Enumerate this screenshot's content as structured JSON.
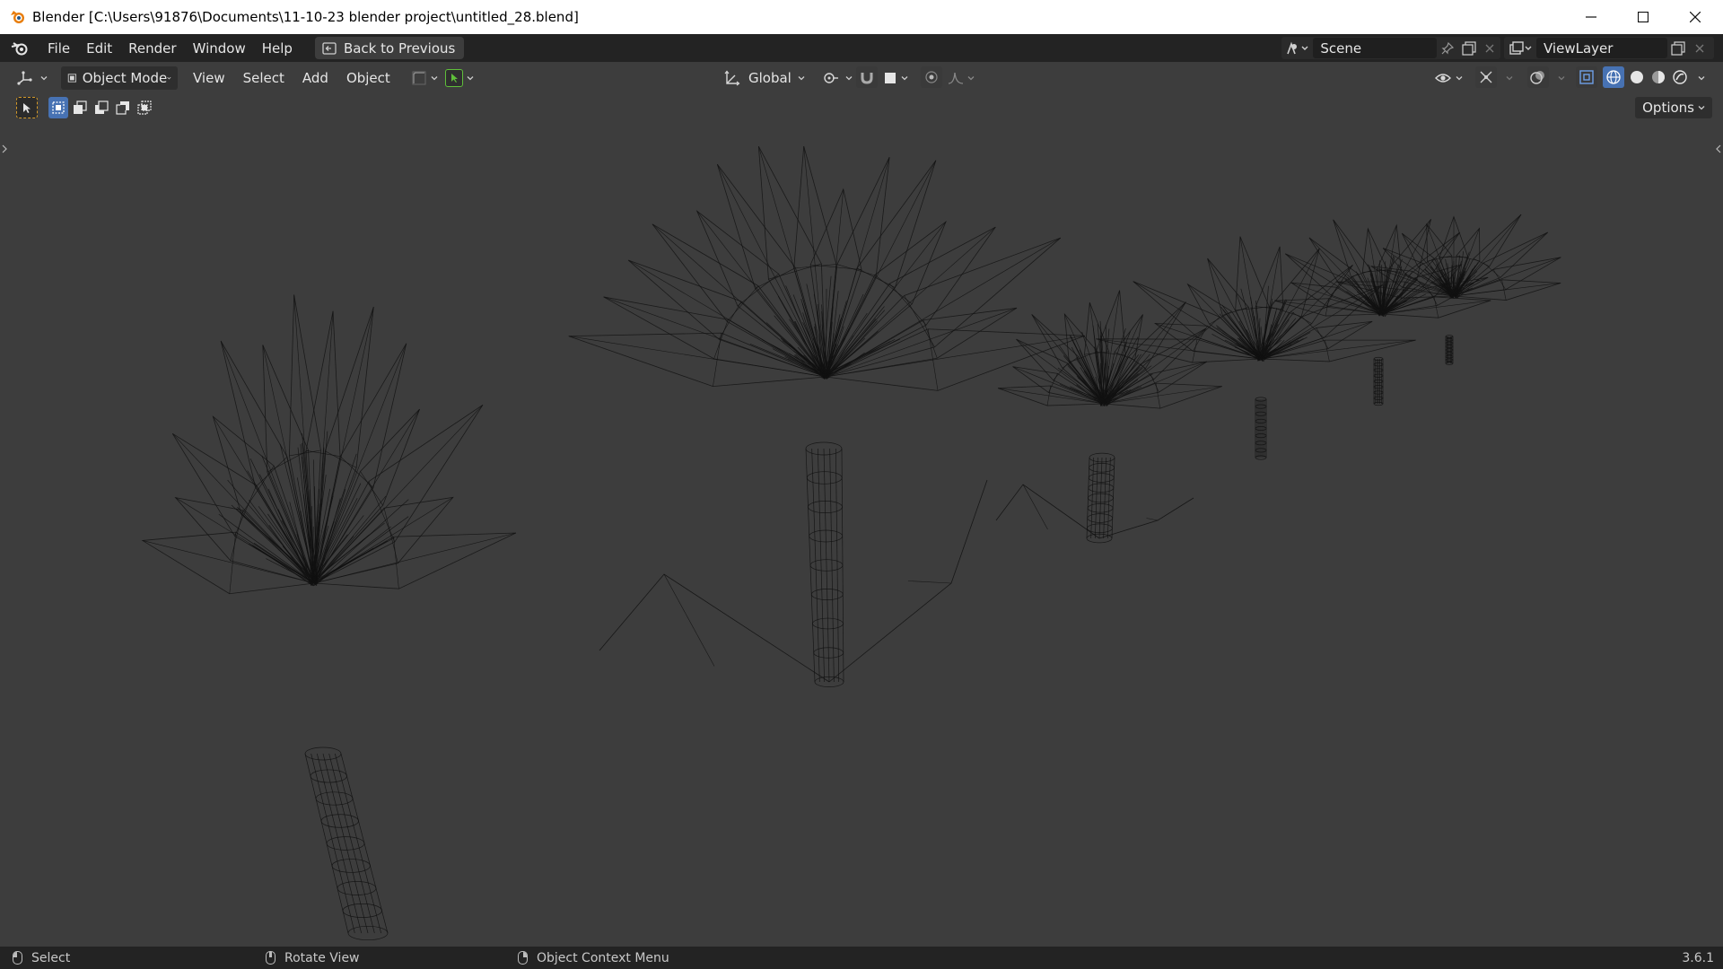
{
  "window": {
    "title": "Blender [C:\\Users\\91876\\Documents\\11-10-23 blender project\\untitled_28.blend]"
  },
  "topbar": {
    "menus": [
      "File",
      "Edit",
      "Render",
      "Window",
      "Help"
    ],
    "back_button": "Back to Previous",
    "scene": "Scene",
    "view_layer": "ViewLayer"
  },
  "viewport_header": {
    "mode": "Object Mode",
    "menus": [
      "View",
      "Select",
      "Add",
      "Object"
    ],
    "transform_orientation": "Global",
    "options": "Options"
  },
  "statusbar": {
    "left_click": "Select",
    "middle_click": "Rotate View",
    "right_click": "Object Context Menu",
    "version": "3.6.1"
  },
  "colors": {
    "accent": "#4772b3",
    "viewport_bg": "#3d3d3d",
    "header_bg": "#232323",
    "wire": "#111111",
    "active_tool_outline": "#d49a2a"
  }
}
